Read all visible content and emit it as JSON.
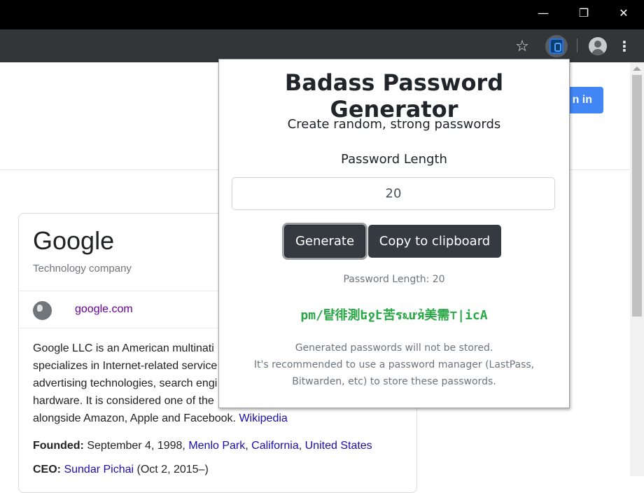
{
  "window": {
    "minimize_glyph": "—",
    "maximize_glyph": "❐",
    "close_glyph": "✕"
  },
  "toolbar": {
    "bookmark_glyph": "☆",
    "menu_glyph": "⋮",
    "icons": [
      "star-icon",
      "extension-icon",
      "account-icon",
      "menu-dots-icon"
    ]
  },
  "background_page": {
    "signin_label": "n in",
    "knowledge_panel": {
      "title": "Google",
      "subtitle": "Technology company",
      "website": "google.com",
      "description_lines": [
        "Google LLC is an American multinati",
        "specializes in Internet-related service",
        "advertising technologies, search engi",
        "hardware. It is considered one of the",
        "alongside Amazon, Apple and Facebook."
      ],
      "wikipedia_link": "Wikipedia",
      "founded": {
        "label": "Founded:",
        "date": "September 4, 1998,",
        "place1": "Menlo Park",
        "place2": "California",
        "place3": "United States"
      },
      "ceo": {
        "label": "CEO:",
        "name": "Sundar Pichai",
        "tenure": "(Oct 2, 2015–)"
      }
    }
  },
  "popup": {
    "title": "Badass Password Generator",
    "subtitle": "Create random, strong passwords",
    "length_label": "Password Length",
    "length_value": "20",
    "generate_label": "Generate",
    "copy_label": "Copy to clipboard",
    "length_status": "Password Length: 20",
    "generated_password": "pm/턑徘測եջէ苦ร೩ửя美需⊤|icA",
    "note_lines": [
      "Generated passwords will not be stored.",
      "It's recommended to use a password manager (LastPass,",
      "Bitwarden, etc) to store these passwords."
    ]
  },
  "colors": {
    "button_dark": "#343a40",
    "password_green": "#28a745",
    "signin_blue": "#4285f4",
    "link_blue": "#1a0dab",
    "visited_purple": "#660099"
  }
}
